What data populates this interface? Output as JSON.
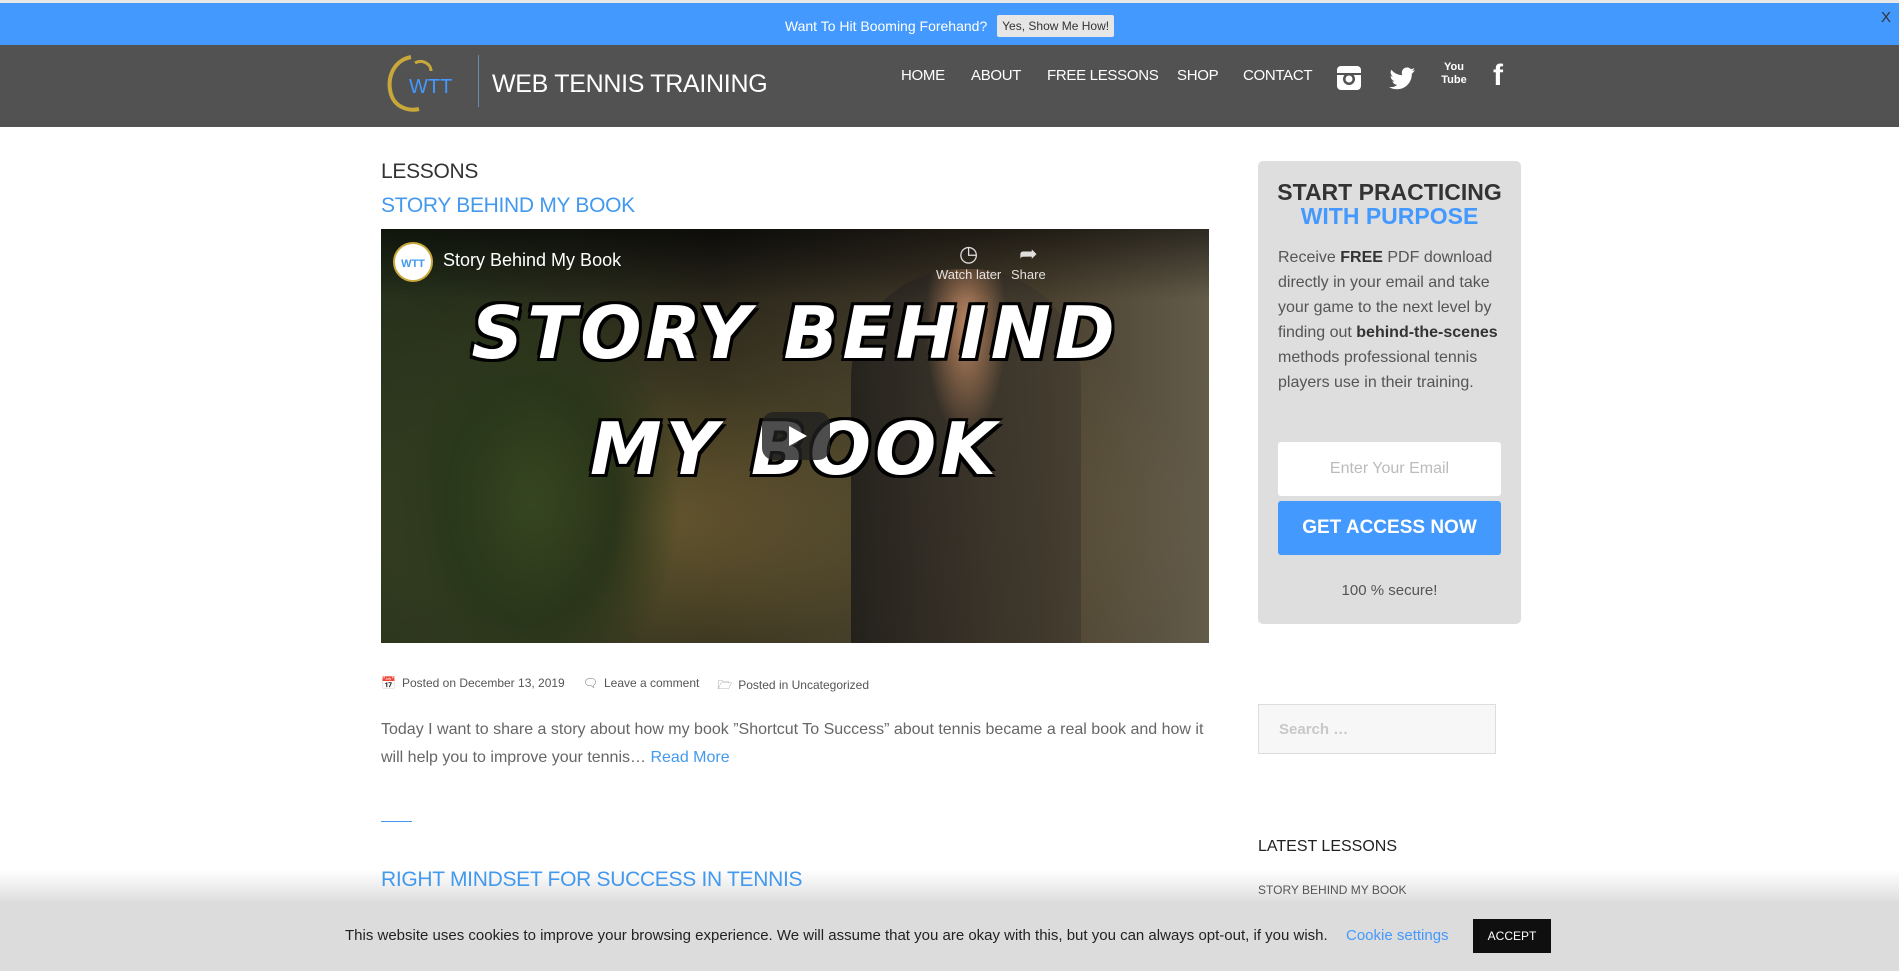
{
  "promo": {
    "text": "Want To Hit Booming Forehand?",
    "button": "Yes, Show Me How!",
    "close": "X",
    "color": "#4399fe"
  },
  "header": {
    "logo_text": "WTT",
    "site_title": "WEB TENNIS TRAINING",
    "nav": [
      "HOME",
      "ABOUT",
      "FREE LESSONS",
      "SHOP",
      "CONTACT"
    ],
    "social": [
      "instagram-icon",
      "twitter-icon",
      "youtube-icon",
      "facebook-icon"
    ],
    "youtube_glyph": "You Tube"
  },
  "main": {
    "section": "LESSONS",
    "post": {
      "title": "STORY BEHIND MY BOOK",
      "video": {
        "channel_logo": "WTT",
        "title": "Story Behind My Book",
        "watch_later": "Watch later",
        "share": "Share",
        "thumbnail_line1": "STORY BEHIND",
        "thumbnail_line2": "MY BOOK"
      },
      "meta": {
        "posted_on": "Posted on December 13, 2019",
        "comment": "Leave a comment",
        "category": "Posted in Uncategorized"
      },
      "excerpt": "Today I want to share a story about how my book ”Shortcut To Success” about tennis became a real book and how it will help you to improve your tennis…",
      "read_more": "Read More"
    },
    "next_post_title": "RIGHT MINDSET FOR SUCCESS IN TENNIS"
  },
  "sidebar": {
    "optin": {
      "heading1": "START PRACTICING",
      "heading2": "WITH PURPOSE",
      "body_1": "Receive ",
      "body_2": "FREE",
      "body_3": " PDF download directly in your email and take your game to the next level by finding out ",
      "body_4": "behind-the-scenes",
      "body_5": " methods professional tennis players use in their training.",
      "email_placeholder": "Enter Your Email",
      "button": "GET ACCESS NOW",
      "secure": "100 % secure!"
    },
    "search_placeholder": "Search …",
    "latest_title": "LATEST LESSONS",
    "latest": [
      "STORY BEHIND MY BOOK"
    ]
  },
  "cookie": {
    "text": "This website uses cookies to improve your browsing experience. We will assume that you are okay with this, but you can always opt-out, if you wish.",
    "settings": "Cookie settings",
    "accept": "ACCEPT"
  }
}
